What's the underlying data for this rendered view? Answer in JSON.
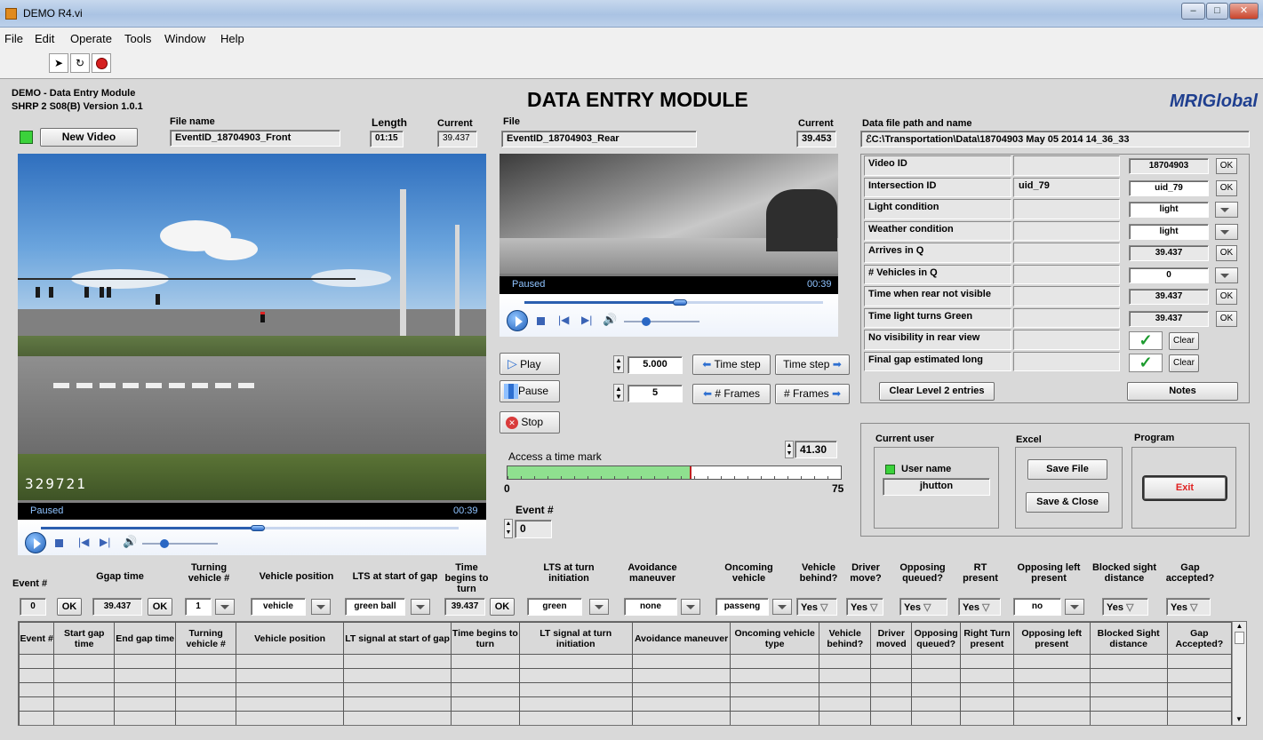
{
  "window": {
    "title": "DEMO R4.vi",
    "min_label": "–",
    "max_label": "□",
    "close_label": "✕"
  },
  "menu": [
    "File",
    "Edit",
    "Operate",
    "Tools",
    "Window",
    "Help"
  ],
  "toolbar": {
    "run_icon": "run-arrow-icon",
    "run_cont_icon": "run-continuously-icon",
    "abort_icon": "abort-icon"
  },
  "header": {
    "module_name": "DEMO - Data Entry Module",
    "version": "SHRP 2 S08(B) Version 1.0.1",
    "title": "DATA ENTRY MODULE",
    "logo": "MRIGlobal"
  },
  "front_video": {
    "new_video_label": "New Video",
    "file_name_label": "File name",
    "file_name": "EventID_18704903_Front",
    "length_label": "Length",
    "length": "01:15",
    "current_label": "Current",
    "current": "39.437",
    "overlay_number": "329721",
    "status": "Paused",
    "time": "00:39",
    "progress": 0.52
  },
  "rear_video": {
    "file_label": "File",
    "file_name": "EventID_18704903_Rear",
    "current_label": "Current",
    "current": "39.453",
    "status": "Paused",
    "time": "00:39",
    "progress": 0.52
  },
  "controls": {
    "play": "Play",
    "pause": "Pause",
    "stop": "Stop",
    "time_step_value": "5.000",
    "frames_value": "5",
    "time_step_back": "Time step",
    "time_step_fwd": "Time step",
    "frames_back": "# Frames",
    "frames_fwd": "# Frames",
    "access_label": "Access a time mark",
    "time_mark": "41.30",
    "slider_min": "0",
    "slider_max": "75",
    "slider_value": 41.3,
    "event_label": "Event #",
    "event_value": "0"
  },
  "data_file": {
    "label": "Data file path and name",
    "path": "C:\\Transportation\\Data\\18704903 May 05 2014 14_36_33"
  },
  "entry_table": [
    {
      "label": "Video ID",
      "value": "",
      "input": "18704903",
      "action": "OK"
    },
    {
      "label": "Intersection ID",
      "value": "uid_79",
      "input": "uid_79",
      "action": "OK"
    },
    {
      "label": "Light condition",
      "value": "",
      "input": "light",
      "action": "dropdown"
    },
    {
      "label": "Weather condition",
      "value": "",
      "input": "light",
      "action": "dropdown"
    },
    {
      "label": "Arrives in Q",
      "value": "",
      "input": "39.437",
      "action": "OK"
    },
    {
      "label": "# Vehicles in Q",
      "value": "",
      "input": "0",
      "action": "dropdown"
    },
    {
      "label": "Time when rear not visible",
      "value": "",
      "input": "39.437",
      "action": "OK"
    },
    {
      "label": "Time light turns Green",
      "value": "",
      "input": "39.437",
      "action": "OK"
    },
    {
      "label": "No visibility in rear view",
      "value": "",
      "input": "check",
      "action": "Clear"
    },
    {
      "label": "Final gap estimated long",
      "value": "",
      "input": "check",
      "action": "Clear"
    }
  ],
  "entry_buttons": {
    "clear_level2": "Clear Level 2 entries",
    "notes": "Notes"
  },
  "user_panel": {
    "current_user_label": "Current user",
    "user_name_label": "User name",
    "user_name": "jhutton",
    "excel_label": "Excel",
    "save_file": "Save File",
    "save_close": "Save & Close",
    "program_label": "Program",
    "exit": "Exit"
  },
  "event_row": {
    "event_label": "Event #",
    "event_value": "0",
    "ok": "OK",
    "ggap_label": "Ggap time",
    "ggap_value": "39.437",
    "turning_label": "Turning vehicle #",
    "turning_value": "1",
    "vehpos_label": "Vehicle position",
    "vehpos_value": "vehicle",
    "lts_start_label": "LTS at start of gap",
    "lts_start_value": "green ball",
    "time_turn_label": "Time begins to turn",
    "time_turn_value": "39.437",
    "lts_turn_label": "LTS at turn initiation",
    "lts_turn_value": "green",
    "avoid_label": "Avoidance maneuver",
    "avoid_value": "none",
    "oncoming_label": "Oncoming vehicle",
    "oncoming_value": "passeng",
    "behind_label": "Vehicle behind?",
    "behind_value": "Yes",
    "driver_label": "Driver move?",
    "driver_value": "Yes",
    "opp_q_label": "Opposing queued?",
    "opp_q_value": "Yes",
    "rt_label": "RT present",
    "rt_value": "Yes",
    "opp_left_label": "Opposing left present",
    "opp_left_value": "no",
    "blocked_label": "Blocked sight distance",
    "blocked_value": "Yes",
    "gap_label": "Gap accepted?",
    "gap_value": "Yes"
  },
  "grid_headers": [
    "Event #",
    "Start gap time",
    "End gap time",
    "Turning vehicle #",
    "Vehicle position",
    "LT signal at start of gap",
    "Time begins to turn",
    "LT signal at turn initiation",
    "Avoidance maneuver",
    "Oncoming vehicle type",
    "Vehicle behind?",
    "Driver moved",
    "Opposing queued?",
    "Right Turn present",
    "Opposing left present",
    "Blocked Sight distance",
    "Gap Accepted?"
  ]
}
